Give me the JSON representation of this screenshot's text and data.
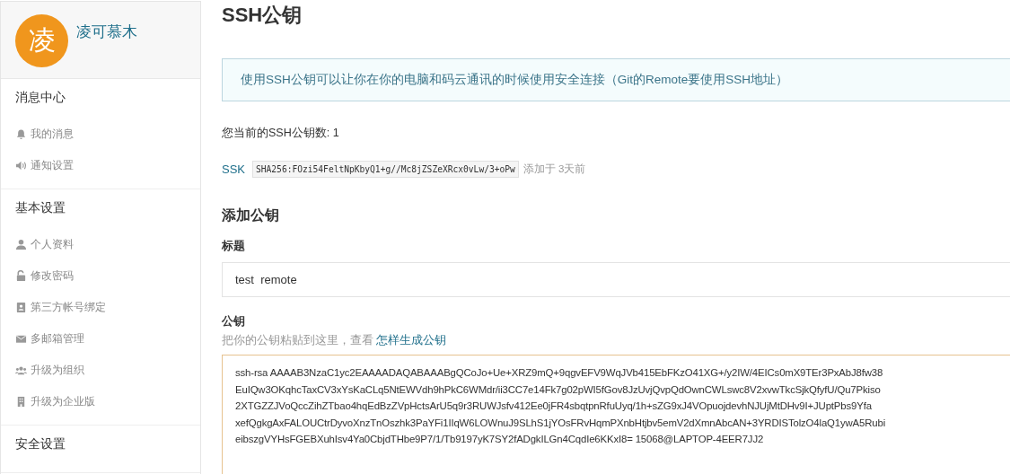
{
  "sidebar": {
    "profile": {
      "avatar": "凌",
      "name": "凌可慕木"
    },
    "groups": [
      {
        "title": "消息中心",
        "items": [
          {
            "label": "我的消息",
            "kind": "bell"
          },
          {
            "label": "通知设置",
            "kind": "speaker"
          }
        ]
      },
      {
        "title": "基本设置",
        "items": [
          {
            "label": "个人资料",
            "kind": "user"
          },
          {
            "label": "修改密码",
            "kind": "lock"
          },
          {
            "label": "第三方帐号绑定",
            "kind": "card"
          },
          {
            "label": "多邮箱管理",
            "kind": "mail"
          },
          {
            "label": "升级为组织",
            "kind": "group"
          },
          {
            "label": "升级为企业版",
            "kind": "building"
          }
        ]
      },
      {
        "title": "安全设置"
      }
    ]
  },
  "main": {
    "title": "SSH公钥",
    "notice": "使用SSH公钥可以让你在你的电脑和码云通讯的时候使用安全连接（Git的Remote要使用SSH地址）",
    "count_text": "您当前的SSH公钥数: 1",
    "keys": [
      {
        "name": "SSK",
        "fingerprint": "SHA256:FOzi54FeltNpKbyQ1+g//Mc8jZSZeXRcx0vLw/3+oPw",
        "added": "添加于 3天前"
      }
    ],
    "add_title": "添加公钥",
    "title_label": "标题",
    "title_value": "test  remote",
    "key_label": "公钥",
    "key_hint": "把你的公钥粘贴到这里，查看",
    "key_hint_link": "怎样生成公钥",
    "key_lines": [
      "ssh-rsa AAAAB3NzaC1yc2EAAAADAQABAAABgQCoJo+Ue+XRZ9mQ+9qgvEFV9WqJVb415EbFKzO41XG+/y2IW/4EICs0mX9TEr3PxAbJ8fw38",
      "EuIQw3OKqhcTaxCV3xYsKaCLq5NtEWVdh9hPkC6WMdr/ii3CC7e14Fk7g02pWI5fGov8JzUvjQvpQdOwnCWLswc8V2xvwTkcSjkQfyfU/Qu7Pkiso",
      "2XTGZZJVoQccZihZTbao4hqEdBzZVpHctsArU5q9r3RUWJsfv412Ee0jFR4sbqtpnRfuUyq/1h+sZG9xJ4VOpuojdevhNJUjMtDHv9I+JUptPbs9Yfa",
      "xefQgkgAxFALOUCtrDyvoXnzTnOszhk3PaYFi1IIqW6LOWnuJ9SLhS1jYOsFRvHqmPXnbHtjbv5emV2dXmnAbcAN+3YRDISTolzO4laQ1ywA5Rubi",
      "eibszgVYHsFGEBXuhIsv4Ya0CbjdTHbe9P7/1/Tb9197yK7SY2fADgkILGn4CqdIe6KKxI8= 15068@LAPTOP-4EER7JJ2"
    ]
  }
}
